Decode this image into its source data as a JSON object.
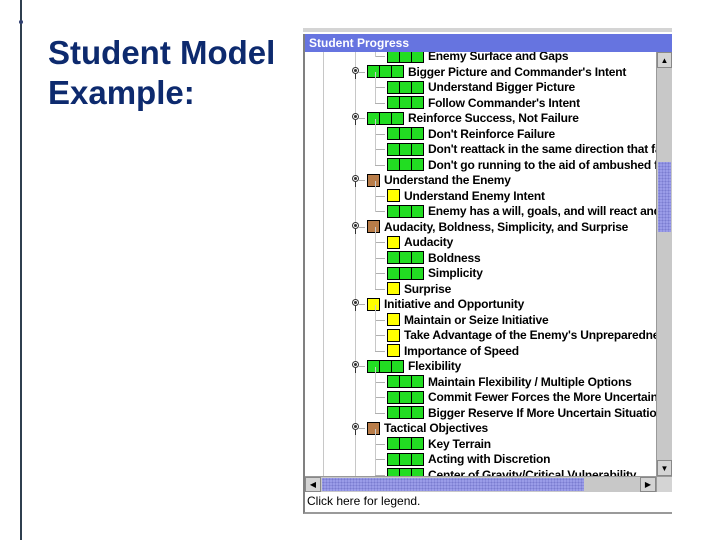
{
  "slide": {
    "title_line1": "Student Model",
    "title_line2": "Example:"
  },
  "panel": {
    "title": "Student Progress",
    "status_text": "Click here for legend.",
    "legend_colors": {
      "mastered": "#22dd22",
      "partial": "#ffff00",
      "not_started": "#b87c48",
      "titlebar": "#6674e0"
    },
    "tree": [
      {
        "label": "Enemy Surface and Gaps",
        "level": 2,
        "status": "mastered",
        "expandable": false
      },
      {
        "label": "Bigger Picture and Commander's Intent",
        "level": 1,
        "status": "mastered",
        "expandable": true
      },
      {
        "label": "Understand Bigger Picture",
        "level": 2,
        "status": "mastered",
        "expandable": false
      },
      {
        "label": "Follow Commander's Intent",
        "level": 2,
        "status": "mastered",
        "expandable": false
      },
      {
        "label": "Reinforce Success, Not Failure",
        "level": 1,
        "status": "mastered",
        "expandable": true
      },
      {
        "label": "Don't Reinforce Failure",
        "level": 2,
        "status": "mastered",
        "expandable": false
      },
      {
        "label": "Don't reattack in the same direction that fa",
        "level": 2,
        "status": "mastered",
        "expandable": false
      },
      {
        "label": "Don't go running to the aid of ambushed fo",
        "level": 2,
        "status": "mastered",
        "expandable": false
      },
      {
        "label": "Understand the Enemy",
        "level": 1,
        "status": "not_started",
        "expandable": true
      },
      {
        "label": "Understand Enemy Intent",
        "level": 2,
        "status": "partial",
        "expandable": false
      },
      {
        "label": "Enemy has a will, goals, and will react and",
        "level": 2,
        "status": "mastered",
        "expandable": false
      },
      {
        "label": "Audacity, Boldness, Simplicity, and Surprise",
        "level": 1,
        "status": "not_started",
        "expandable": true
      },
      {
        "label": "Audacity",
        "level": 2,
        "status": "partial",
        "expandable": false
      },
      {
        "label": "Boldness",
        "level": 2,
        "status": "mastered",
        "expandable": false
      },
      {
        "label": "Simplicity",
        "level": 2,
        "status": "mastered",
        "expandable": false
      },
      {
        "label": "Surprise",
        "level": 2,
        "status": "partial",
        "expandable": false
      },
      {
        "label": "Initiative and Opportunity",
        "level": 1,
        "status": "partial",
        "expandable": true
      },
      {
        "label": "Maintain or Seize Initiative",
        "level": 2,
        "status": "partial",
        "expandable": false
      },
      {
        "label": "Take Advantage of the Enemy's Unpreparedne",
        "level": 2,
        "status": "partial",
        "expandable": false
      },
      {
        "label": "Importance of Speed",
        "level": 2,
        "status": "partial",
        "expandable": false
      },
      {
        "label": "Flexibility",
        "level": 1,
        "status": "mastered",
        "expandable": true
      },
      {
        "label": "Maintain Flexibility / Multiple Options",
        "level": 2,
        "status": "mastered",
        "expandable": false
      },
      {
        "label": "Commit Fewer Forces the More Uncertain t",
        "level": 2,
        "status": "mastered",
        "expandable": false
      },
      {
        "label": "Bigger Reserve If More Uncertain Situation",
        "level": 2,
        "status": "mastered",
        "expandable": false
      },
      {
        "label": "Tactical Objectives",
        "level": 1,
        "status": "not_started",
        "expandable": true
      },
      {
        "label": "Key Terrain",
        "level": 2,
        "status": "mastered",
        "expandable": false
      },
      {
        "label": "Acting with Discretion",
        "level": 2,
        "status": "mastered",
        "expandable": false
      },
      {
        "label": "Center of Gravity/Critical Vulnerability",
        "level": 2,
        "status": "mastered",
        "expandable": false
      }
    ],
    "scrollbars": {
      "up_icon": "▲",
      "down_icon": "▼",
      "left_icon": "◀",
      "right_icon": "▶"
    }
  }
}
